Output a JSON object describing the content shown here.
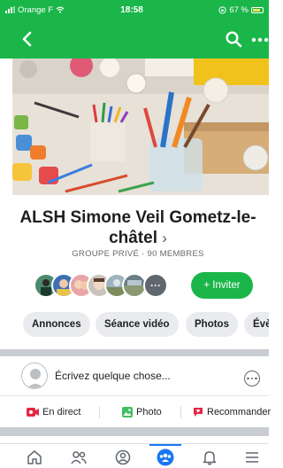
{
  "status_bar": {
    "carrier": "Orange F",
    "time": "18:58",
    "battery_text": "67 %"
  },
  "nav": {
    "back_icon": "chevron-left-icon",
    "search_icon": "search-icon",
    "more_icon": "more-horizontal-icon"
  },
  "group": {
    "name": "ALSH Simone Veil Gometz-le-châtel",
    "name_chevron": "›",
    "meta": "GROUPE PRIVÉ · 90 MEMBRES"
  },
  "members": {
    "more_label": "···",
    "invite_label": "+ Inviter"
  },
  "chips": [
    "Annonces",
    "Séance vidéo",
    "Photos",
    "Évè"
  ],
  "composer": {
    "placeholder": "Écrivez quelque chose..."
  },
  "actions": [
    {
      "label": "En direct",
      "icon": "live-video-icon"
    },
    {
      "label": "Photo",
      "icon": "photo-icon"
    },
    {
      "label": "Recommander",
      "icon": "recommend-icon"
    }
  ],
  "tabs": [
    {
      "icon": "home-icon",
      "active": false
    },
    {
      "icon": "friends-icon",
      "active": false
    },
    {
      "icon": "profile-icon",
      "active": false
    },
    {
      "icon": "groups-icon",
      "active": true
    },
    {
      "icon": "notifications-icon",
      "active": false
    },
    {
      "icon": "menu-icon",
      "active": false
    }
  ],
  "colors": {
    "brand_green": "#1bb64a",
    "active_blue": "#1877f2",
    "chip_bg": "#e9ebee"
  }
}
